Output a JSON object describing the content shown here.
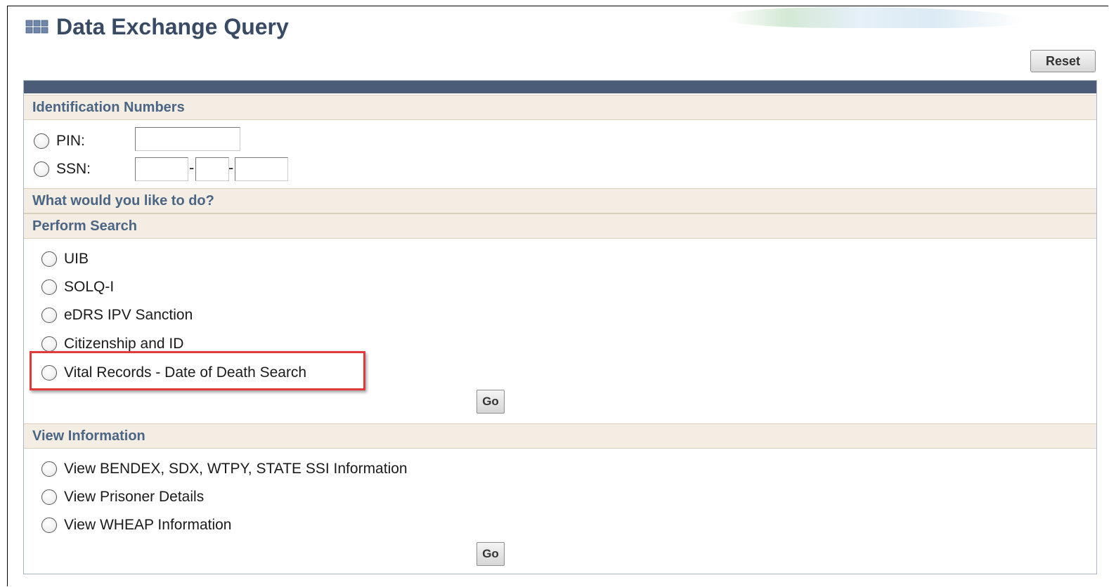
{
  "header": {
    "title": "Data Exchange Query",
    "title_icon": "grid-icon",
    "reset_label": "Reset"
  },
  "sections": {
    "identification": {
      "heading": "Identification Numbers",
      "pin_label": "PIN:",
      "pin_value": "",
      "ssn_label": "SSN:",
      "ssn_part1": "",
      "ssn_part2": "",
      "ssn_part3": "",
      "ssn_separator": "-"
    },
    "question": {
      "heading": "What would you like to do?"
    },
    "perform_search": {
      "heading": "Perform Search",
      "options": [
        "UIB",
        "SOLQ-I",
        "eDRS IPV Sanction",
        "Citizenship and ID",
        "Vital Records - Date of Death Search"
      ],
      "go_label": "Go"
    },
    "view_information": {
      "heading": "View Information",
      "options": [
        "View BENDEX, SDX, WTPY, STATE SSI Information",
        "View Prisoner Details",
        "View WHEAP Information"
      ],
      "go_label": "Go"
    }
  },
  "colors": {
    "title": "#384a64",
    "section_heading": "#4b6585",
    "section_background": "#f3ede3",
    "panel_bar": "#4a5c78",
    "highlight": "#e23a3a"
  }
}
